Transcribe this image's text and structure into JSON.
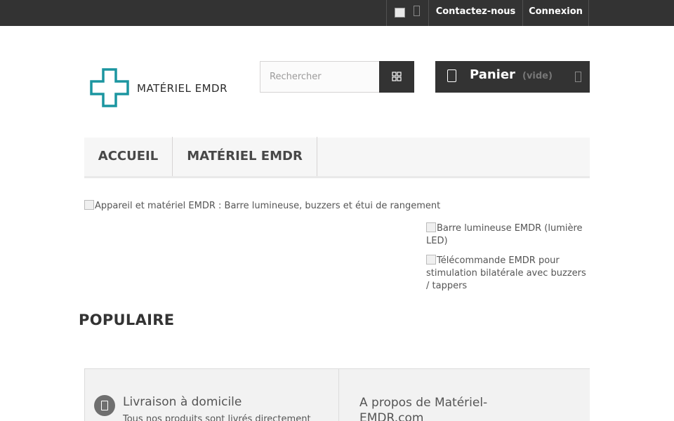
{
  "topbar": {
    "language_icon": "flag-icon",
    "contact_label": "Contactez-nous",
    "login_label": "Connexion"
  },
  "header": {
    "logo_text": "MATÉRIEL EMDR",
    "logo_color": "#1b95a0",
    "search": {
      "placeholder": "Rechercher",
      "value": ""
    },
    "cart": {
      "label": "Panier",
      "status": "(vide)"
    }
  },
  "menu": {
    "items": [
      {
        "label": "ACCUEIL"
      },
      {
        "label": "MATÉRIEL EMDR"
      }
    ]
  },
  "banner": {
    "main_alt": "Appareil et matériel EMDR : Barre lumineuse, buzzers et étui de rangement",
    "side": [
      {
        "alt": "Barre lumineuse EMDR (lumière LED)"
      },
      {
        "alt": "Télécommande EMDR pour stimulation bilatérale avec buzzers / tappers"
      }
    ]
  },
  "section_title": "POPULAIRE",
  "footer": {
    "delivery_title": "Livraison à domicile",
    "delivery_text": "Tous nos produits sont livrés directement",
    "about_title": "A propos de Matériel-EMDR.com"
  },
  "colors": {
    "topbar": "#333333",
    "accent_dark": "#333333",
    "logo_teal": "#1b95a0"
  }
}
